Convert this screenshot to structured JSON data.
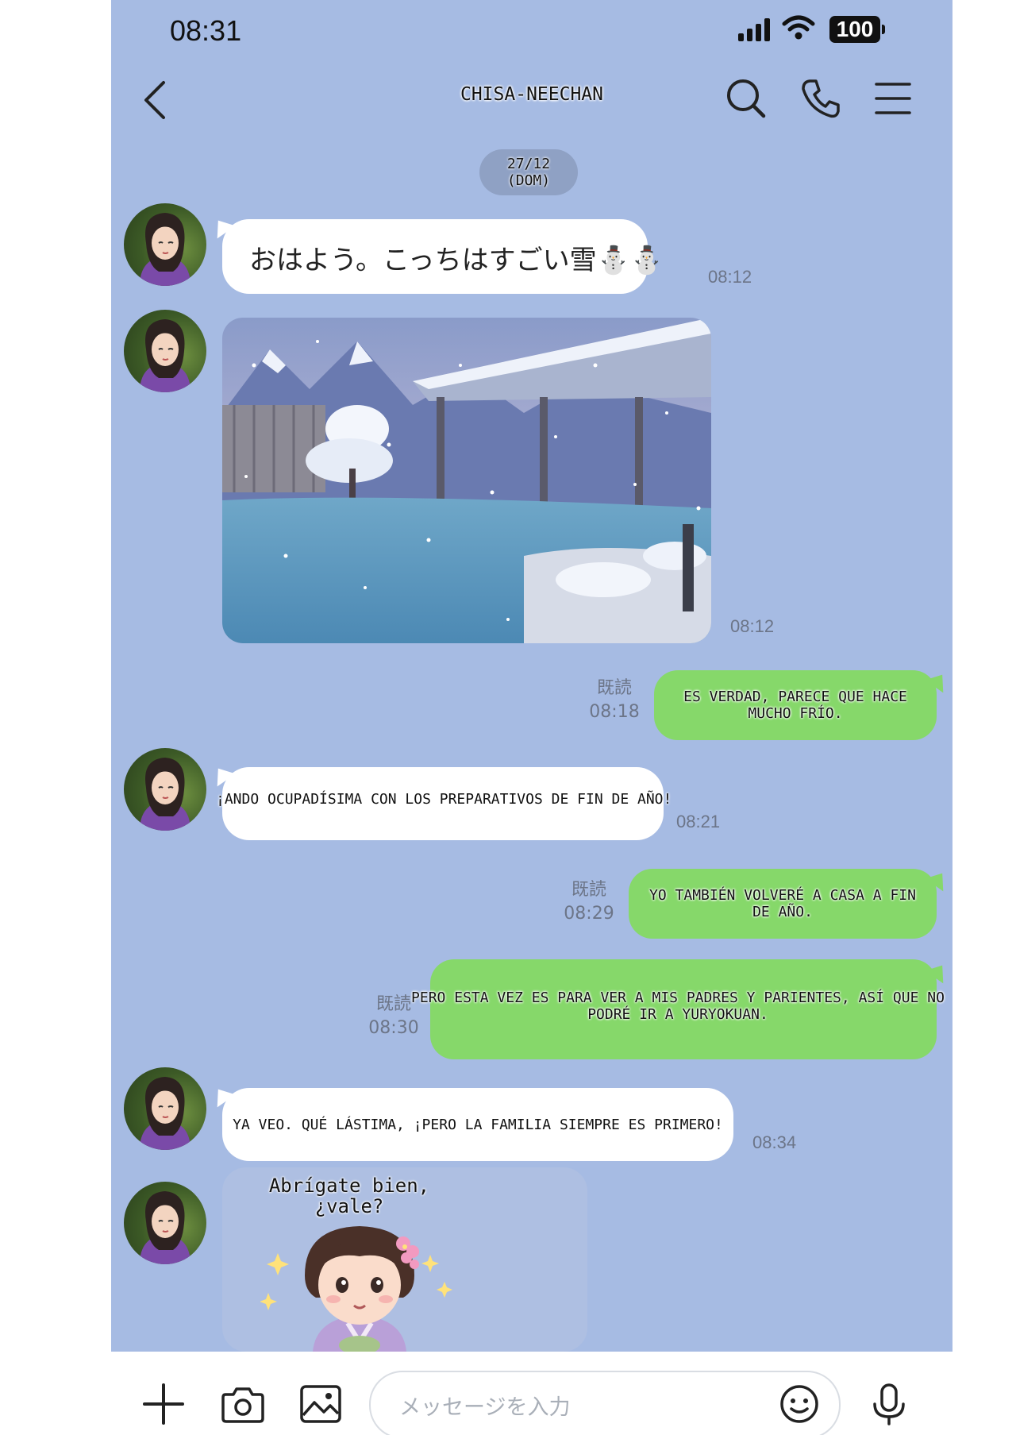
{
  "status_bar": {
    "time": "08:31",
    "battery": "100"
  },
  "header": {
    "title": "CHISA-NEECHAN"
  },
  "date_separator": {
    "line1": "27/12",
    "line2": "(DOM)"
  },
  "messages": [
    {
      "side": "in",
      "text": "おはよう。こっちはすごい雪⛄⛄",
      "time": "08:12"
    },
    {
      "side": "in",
      "type": "image",
      "time": "08:12"
    },
    {
      "side": "out",
      "read": "既読",
      "text": "ES VERDAD, PARECE QUE HACE MUCHO FRÍO.",
      "time": "08:18"
    },
    {
      "side": "in",
      "text": "¡ANDO OCUPADÍSIMA CON LOS PREPARATIVOS DE FIN DE AÑO!",
      "time": "08:21"
    },
    {
      "side": "out",
      "read": "既読",
      "text": "YO TAMBIÉN VOLVERÉ A CASA A FIN DE AÑO.",
      "time": "08:29"
    },
    {
      "side": "out",
      "read": "既読",
      "text": "PERO ESTA VEZ ES PARA VER A MIS PADRES Y PARIENTES, ASÍ QUE NO PODRÉ IR A YURYOKUAN.",
      "time": "08:30"
    },
    {
      "side": "in",
      "text": "YA VEO. QUÉ LÁSTIMA, ¡PERO LA FAMILIA SIEMPRE ES PRIMERO!",
      "time": "08:34"
    },
    {
      "side": "in",
      "type": "sticker",
      "text": "Abrígate bien, ¿vale?"
    }
  ],
  "input": {
    "placeholder": "メッセージを入力"
  },
  "icons": [
    "back-chevron-icon",
    "search-icon",
    "phone-icon",
    "menu-icon",
    "plus-icon",
    "camera-icon",
    "image-icon",
    "emoji-icon",
    "microphone-icon"
  ],
  "colors": {
    "background": "#a6bbe3",
    "outgoing_bubble": "#86d86a",
    "incoming_bubble": "#ffffff"
  }
}
